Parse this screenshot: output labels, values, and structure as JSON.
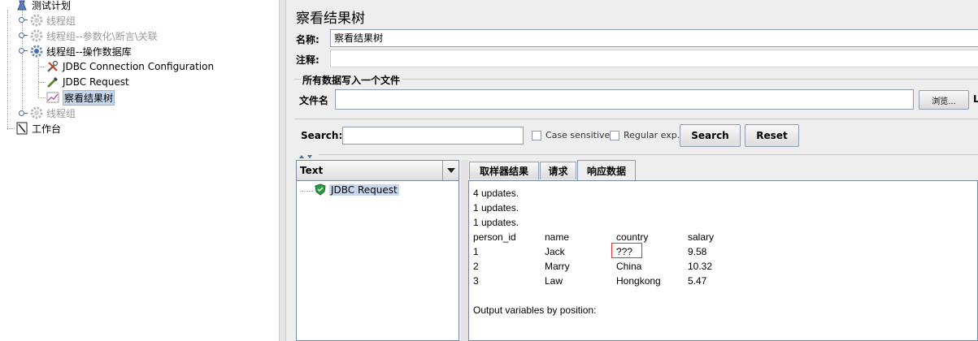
{
  "tree": {
    "nodes": [
      {
        "label": "测试计划",
        "disabled": false
      },
      {
        "label": "线程组",
        "disabled": true
      },
      {
        "label": "线程组--参数化\\断言\\关联",
        "disabled": true
      },
      {
        "label": "线程组--操作数据库",
        "disabled": false
      },
      {
        "label": "JDBC Connection Configuration",
        "disabled": false
      },
      {
        "label": "JDBC Request",
        "disabled": false
      },
      {
        "label": "察看结果树",
        "disabled": false,
        "selected": true
      },
      {
        "label": "线程组",
        "disabled": true
      },
      {
        "label": "工作台",
        "disabled": false
      }
    ]
  },
  "panel": {
    "title": "察看结果树",
    "name_label": "名称:",
    "name_value": "察看结果树",
    "comment_label": "注释:",
    "comment_value": "",
    "writeall_label": "所有数据写入一个文件",
    "filename_label": "文件名",
    "filename_value": "",
    "browse_label": "浏览...",
    "cutoff_glyph": "L"
  },
  "search": {
    "label": "Search:",
    "value": "",
    "case_sensitive_label": "Case sensitive",
    "regex_label": "Regular exp.",
    "search_button": "Search",
    "reset_button": "Reset"
  },
  "results": {
    "renderer": "Text",
    "samples": [
      {
        "label": "JDBC Request",
        "status": "success"
      }
    ]
  },
  "tabs": [
    {
      "label": "取样器结果",
      "active": false
    },
    {
      "label": "请求",
      "active": false
    },
    {
      "label": "响应数据",
      "active": true
    }
  ],
  "response": {
    "lines": [
      "4 updates.",
      "1 updates.",
      "1 updates."
    ],
    "columns": [
      "person_id",
      "name",
      "country",
      "salary"
    ],
    "rows": [
      [
        "1",
        "Jack",
        "???",
        "9.58"
      ],
      [
        "2",
        "Marry",
        "China",
        "10.32"
      ],
      [
        "3",
        "Law",
        "Hongkong",
        "5.47"
      ]
    ],
    "footer": "Output variables by position:"
  },
  "colors": {
    "highlight": "#e03030",
    "selection": "#c8d8ec",
    "success": "#2a9a3a"
  }
}
